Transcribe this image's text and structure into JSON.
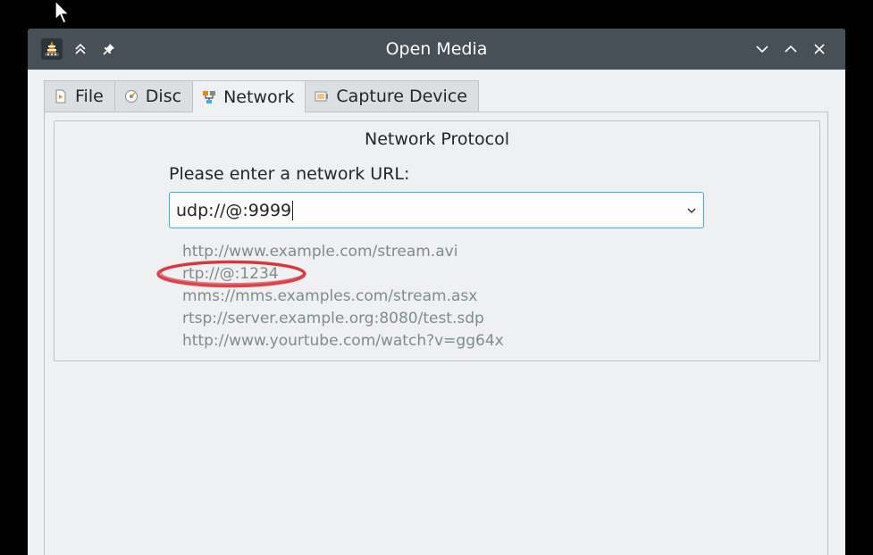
{
  "window": {
    "title": "Open Media"
  },
  "tabs": [
    {
      "label": "File",
      "icon": "file-icon",
      "active": false
    },
    {
      "label": "Disc",
      "icon": "disc-icon",
      "active": false
    },
    {
      "label": "Network",
      "icon": "network-icon",
      "active": true
    },
    {
      "label": "Capture Device",
      "icon": "capture-device-icon",
      "active": false
    }
  ],
  "network": {
    "group_title": "Network Protocol",
    "url_label": "Please enter a network URL:",
    "url_value": "udp://@:9999",
    "examples": [
      "http://www.example.com/stream.avi",
      "rtp://@:1234",
      "mms://mms.examples.com/stream.asx",
      "rtsp://server.example.org:8080/test.sdp",
      "http://www.yourtube.com/watch?v=gg64x"
    ]
  },
  "colors": {
    "titlebar": "#475057",
    "window_bg": "#eff0f1",
    "focus_border": "#3daee9",
    "annotation": "#d9242f"
  }
}
